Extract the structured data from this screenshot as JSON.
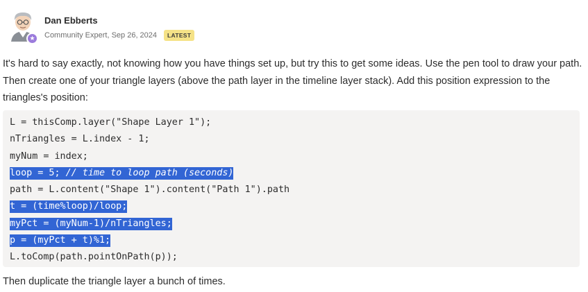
{
  "post": {
    "author": "Dan Ebberts",
    "meta": "Community Expert, Sep 26, 2024",
    "badge": "LATEST",
    "intro": "It's hard to say exactly, not knowing how you have things set up, but try this to get some ideas. Use the pen tool to draw your path. Then create one of your triangle layers (above the path layer in the timeline layer stack). Add this position expression to the triangles's position:",
    "code": {
      "l1": "L = thisComp.layer(\"Shape Layer 1\");",
      "l2": "nTriangles = L.index - 1;",
      "l3": "myNum = index;",
      "l4a": "loop = 5; ",
      "l4b": "// time to loop path (seconds)",
      "l5": "path = L.content(\"Shape 1\").content(\"Path 1\").path",
      "l6": "t = (time%loop)/loop;",
      "l7": "myPct = (myNum-1)/nTriangles;",
      "l8": "p = (myPct + t)%1;",
      "l9": "L.toComp(path.pointOnPath(p));"
    },
    "outro": "Then duplicate the triangle layer a bunch of times.",
    "icons": {
      "avatar": "user-avatar-icon",
      "star": "community-expert-star-icon"
    },
    "colors": {
      "selection": "#3265d4",
      "code_bg": "#f4f3f2",
      "badge_bg": "#f5e287"
    }
  }
}
